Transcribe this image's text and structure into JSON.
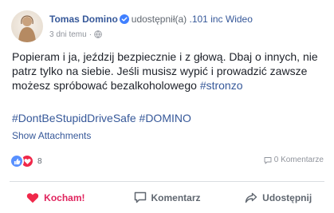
{
  "post": {
    "author": "Tomas Domino",
    "action_text": "udostępnił(a)",
    "shared_page": ".101 inc Wideo",
    "time": "3 dni temu",
    "time_separator": "·",
    "text_main": "Popieram i ja, jeździj bezpiecznie i z głową. Dbaj o innych, nie patrz tylko na siebie. Jeśli musisz wypić i prowadzić zawsze możesz spróbować bezalkoholowego ",
    "text_hashtag": "#stronzo",
    "hashtags": "#DontBeStupidDriveSafe #DOMINO",
    "attachments_link": "Show Attachments"
  },
  "stats": {
    "reaction_count": "8",
    "comments": "0 Komentarze"
  },
  "actions": {
    "love_label": "Kocham!",
    "comment_label": "Komentarz",
    "share_label": "Udostępnij"
  },
  "colors": {
    "link": "#365899",
    "verified": "#4080ff",
    "like": "#5890ff",
    "love": "#f0284a",
    "love_text": "#e0245e"
  }
}
